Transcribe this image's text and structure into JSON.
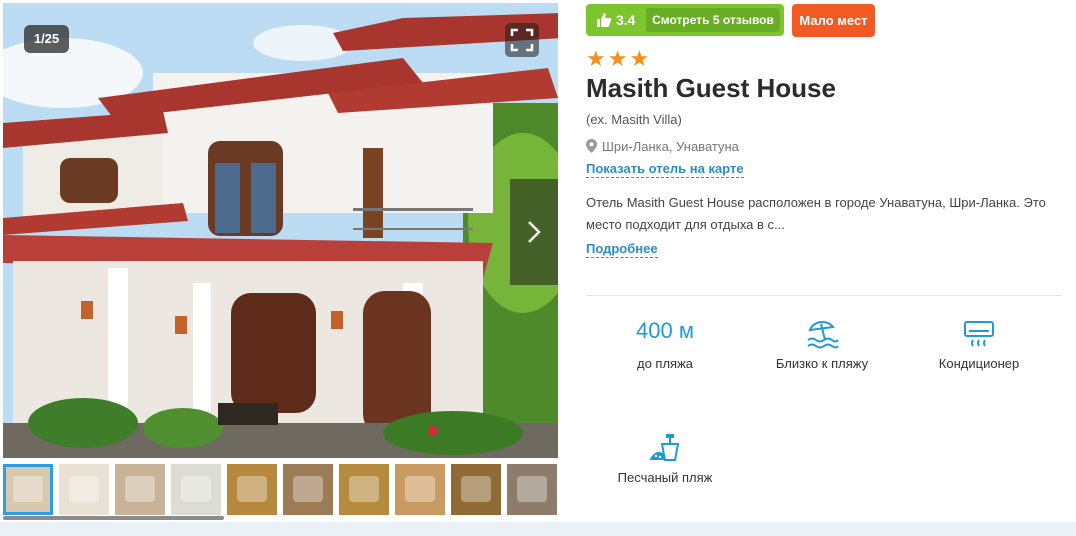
{
  "gallery": {
    "counter": "1/25",
    "thumbnails": [
      {
        "icon": "house-photo",
        "color": "#d9c8b0"
      },
      {
        "icon": "bed-towels-photo",
        "color": "#e8e1d4"
      },
      {
        "icon": "sink-photo",
        "color": "#c9b49a"
      },
      {
        "icon": "towels-photo",
        "color": "#dcdcd4"
      },
      {
        "icon": "room-photo",
        "color": "#b7893f"
      },
      {
        "icon": "bathroom-photo",
        "color": "#9c7b55"
      },
      {
        "icon": "basin-photo",
        "color": "#b58b3e"
      },
      {
        "icon": "corridor-photo",
        "color": "#c99a62"
      },
      {
        "icon": "lamp-photo",
        "color": "#8f6a34"
      },
      {
        "icon": "shower-photo",
        "color": "#8d7b6c"
      }
    ]
  },
  "badges": {
    "rating": "3.4",
    "reviews_label": "Смотреть 5 отзывов",
    "few_places_label": "Мало мест"
  },
  "hotel": {
    "stars": "★★★",
    "name": "Masith Guest House",
    "ex_name": "(ex. Masith Villa)",
    "location": "Шри-Ланка, Унаватуна",
    "map_link": "Показать отель на карте",
    "description": "Отель Masith Guest House расположен в городе Унаватуна, Шри-Ланка. Это место подходит для отдыха в с...",
    "more_link": "Подробнее"
  },
  "features": [
    {
      "value": "400 м",
      "label": "до пляжа"
    },
    {
      "icon": "beach-umbrella-icon",
      "label": "Близко к пляжу"
    },
    {
      "icon": "air-conditioner-icon",
      "label": "Кондиционер"
    },
    {
      "icon": "sand-bucket-icon",
      "label": "Песчаный пляж"
    }
  ],
  "colors": {
    "rating_badge": "#7cc52e",
    "few_places": "#f15a22",
    "stars": "#f4901e",
    "link": "#2a8dc8",
    "feature_accent": "#1e9ad6"
  }
}
